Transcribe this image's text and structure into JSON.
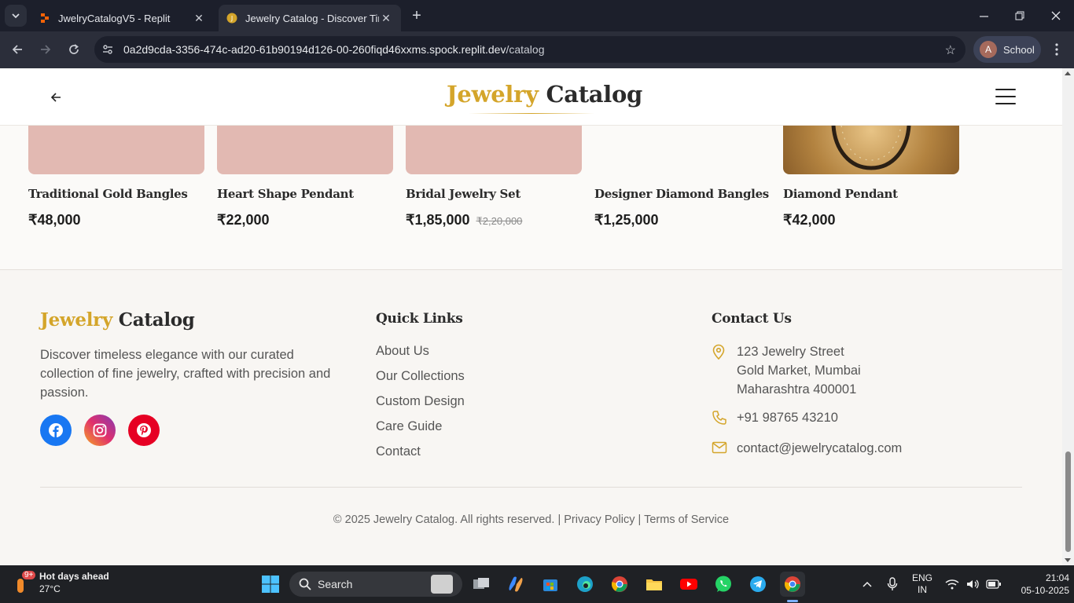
{
  "browser": {
    "tabs": [
      {
        "title": "JwelryCatalogV5 - Replit",
        "active": false
      },
      {
        "title": "Jewelry Catalog - Discover Time",
        "active": true
      }
    ],
    "url_host": "0a2d9cda-3356-474c-ad20-61b90194d126-00-260fiqd46xxms.spock.replit.dev",
    "url_path": "/catalog",
    "profile_initial": "A",
    "profile_label": "School"
  },
  "site": {
    "logo_part1": "Jewelry",
    "logo_part2": "Catalog",
    "colors": {
      "gold": "#d4a52a",
      "dark": "#2b2b2b",
      "card_placeholder": "#e2b9b2"
    }
  },
  "products": [
    {
      "name": "Traditional Gold Bangles",
      "price": "₹48,000",
      "old_price": ""
    },
    {
      "name": "Heart Shape Pendant",
      "price": "₹22,000",
      "old_price": ""
    },
    {
      "name": "Bridal Jewelry Set",
      "price": "₹1,85,000",
      "old_price": "₹2,20,000"
    },
    {
      "name": "Designer Diamond Bangles",
      "price": "₹1,25,000",
      "old_price": ""
    },
    {
      "name": "Diamond Pendant",
      "price": "₹42,000",
      "old_price": ""
    }
  ],
  "footer": {
    "logo_part1": "Jewelry",
    "logo_part2": "Catalog",
    "description": "Discover timeless elegance with our curated collection of fine jewelry, crafted with precision and passion.",
    "quick_links_heading": "Quick Links",
    "quick_links": [
      "About Us",
      "Our Collections",
      "Custom Design",
      "Care Guide",
      "Contact"
    ],
    "contact_heading": "Contact Us",
    "address_line1": "123 Jewelry Street",
    "address_line2": "Gold Market, Mumbai",
    "address_line3": "Maharashtra 400001",
    "phone": "+91 98765 43210",
    "email": "contact@jewelrycatalog.com",
    "copyright": "© 2025 Jewelry Catalog. All rights reserved.",
    "privacy": "Privacy Policy",
    "terms": "Terms of Service",
    "separator": "|"
  },
  "taskbar": {
    "weather_title": "Hot days ahead",
    "weather_temp": "27°C",
    "weather_badge": "9+",
    "search_label": "Search",
    "lang_line1": "ENG",
    "lang_line2": "IN",
    "time": "21:04",
    "date": "05-10-2025"
  }
}
